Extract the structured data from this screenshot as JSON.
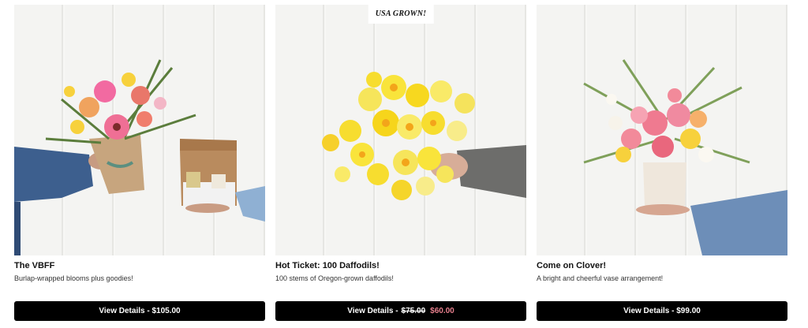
{
  "products": [
    {
      "name": "The VBFF",
      "description": "Burlap-wrapped blooms plus goodies!",
      "button_label": "View Details - $105.00",
      "image_icon": "bouquet-with-gift-box-image"
    },
    {
      "badge": "USA GROWN!",
      "name": "Hot Ticket: 100 Daffodils!",
      "description": "100 stems of Oregon-grown daffodils!",
      "button_prefix": "View Details -",
      "original_price": "$75.00",
      "sale_price": "$60.00",
      "image_icon": "daffodil-bundle-image"
    },
    {
      "name": "Come on Clover!",
      "description": "A bright and cheerful vase arrangement!",
      "button_label": "View Details - $99.00",
      "image_icon": "vase-arrangement-image"
    }
  ],
  "colors": {
    "button_bg": "#000000",
    "button_text": "#ffffff",
    "sale_price": "#e77f8d"
  }
}
